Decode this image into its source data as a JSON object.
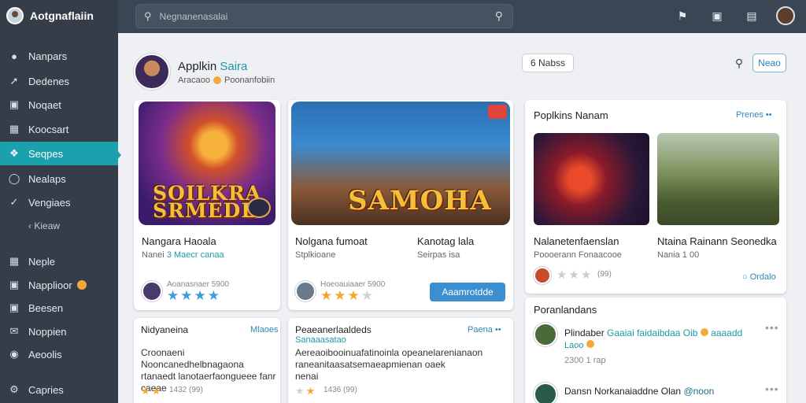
{
  "app": {
    "name": "Aotgnaflaiin"
  },
  "sidebar": {
    "items": [
      {
        "label": "Nanpars",
        "icon": "home-icon"
      },
      {
        "label": "Dedenes",
        "icon": "pin-icon"
      },
      {
        "label": "Noqaet",
        "icon": "bag-icon"
      },
      {
        "label": "Koocsart",
        "icon": "calendar-icon"
      },
      {
        "label": "Seqpes",
        "icon": "compass-icon",
        "active": true
      },
      {
        "label": "Nealaps",
        "icon": "clock-icon"
      },
      {
        "label": "Vengiaes",
        "icon": "check-icon"
      }
    ],
    "sub_label": "Kieaw",
    "items2": [
      {
        "label": "Neple",
        "icon": "grid-icon"
      },
      {
        "label": "Napplioor",
        "icon": "chat-icon",
        "badge": true
      },
      {
        "label": "Beesen",
        "icon": "folder-icon"
      },
      {
        "label": "Noppien",
        "icon": "mail-icon"
      },
      {
        "label": "Aeoolis",
        "icon": "globe-icon"
      }
    ],
    "footer": {
      "label": "Capries",
      "icon": "gear-icon"
    }
  },
  "search": {
    "placeholder": "Negnanenasalai"
  },
  "main": {
    "title": "Applkin",
    "title_accent": "Saira",
    "subtitle_prefix": "Aracaoo",
    "subtitle_suffix": "Poonanfobiin",
    "header_button": "6 Nabss",
    "right_button": "Neao"
  },
  "games": [
    {
      "hero_text": "SOILKRA\nSRMEDE",
      "title": "Nangara Haoala",
      "sub": "Nanei",
      "sub_accent": "3 Maecr canaa",
      "meta": "Aoanasnaer 5900"
    },
    {
      "hero_text": "SAMOHA",
      "title": "Nolgana fumoat",
      "sub": "Stplkioane",
      "title2": "Kanotag lala",
      "sub2": "Seirpas isa",
      "meta": "Hoeoauiaaer 5900",
      "button": "Aaamrotdde"
    }
  ],
  "popular": {
    "title": "Poplkins Nanam",
    "link": "Prenes",
    "items": [
      {
        "title": "Nalanetenfaenslan",
        "sub": "Poooerann Fonaacooe",
        "rating": "(99)"
      },
      {
        "title": "Ntaina Rainann Seonedka",
        "sub": "Nania 1 00",
        "link": "Ordalo"
      }
    ]
  },
  "reviews_left": {
    "title": "Nidyaneina",
    "link": "Mlaoes",
    "body": "Croonaeni Nooncanedhelbnagaona\nrtanaedt lanotaerfaongueee fanr\ncaeae",
    "meta": "1432 (99)"
  },
  "reviews_right": {
    "title": "Peaeanerlaaldeds",
    "subtitle": "Sanaaasatao",
    "link": "Paena",
    "body": "Aereaoibooinuafatinoinla opeanelarenianaon\nraneanitaasatsemaeapmienan oaek\nnenai",
    "meta": "1436 (99)"
  },
  "friends": {
    "title": "Poranlandans",
    "items": [
      {
        "name": "Plindaber",
        "status": "Gaaiai faidaibdaa Oib",
        "status2": "aaaadd",
        "extra": "Laoo",
        "time": "2300 1 rap"
      },
      {
        "name": "Dansn Norkanaiaddne Olan",
        "status": "@noon",
        "time": ""
      }
    ]
  },
  "colors": {
    "accent": "#1aa1ad",
    "sidebar": "#353d49",
    "topbar": "#3a4654",
    "primary": "#3b8ed0",
    "star": "#f3a82a",
    "star_blue": "#3b9ed8"
  }
}
